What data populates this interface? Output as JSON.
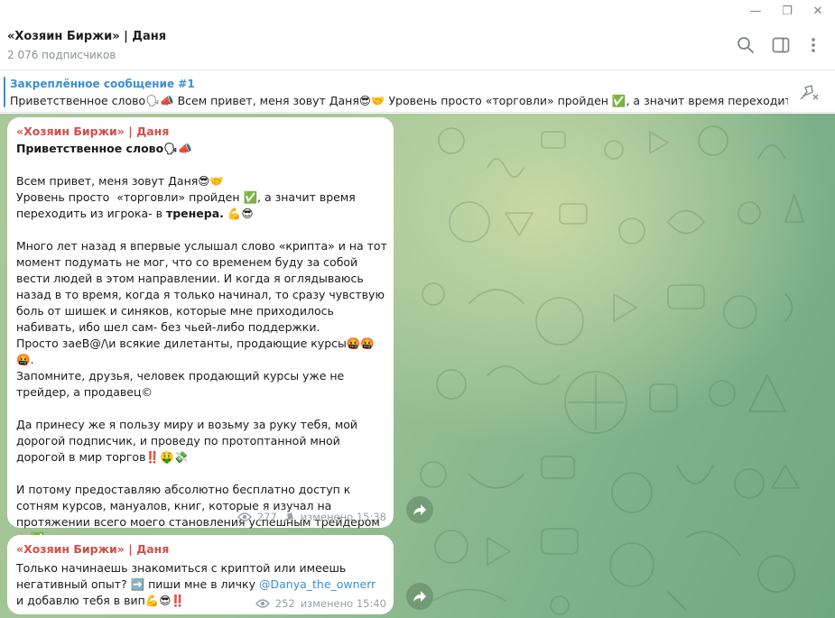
{
  "window": {
    "min": "—",
    "max": "❐",
    "close": "✕"
  },
  "header": {
    "title": "«Хозяин Биржи» | Даня",
    "subtitle": "2 076 подписчиков"
  },
  "pinned": {
    "title": "Закреплённое сообщение #1",
    "text": "Приветственное слово🗣📣  Всем привет, меня зовут Даня😎🤝 Уровень просто  «торговли» пройден ✅, а значит время переходит..."
  },
  "messages": [
    {
      "sender": "«Хозяин Биржи» | Даня",
      "title_line": "Приветственное слово🗣📣",
      "p1": "Всем привет, меня зовут Даня😎🤝\nУровень просто  «торговли» пройден ✅, а значит время переходить из игрока- в ",
      "p1_bold": "тренера.",
      "p1_end": " 💪😎",
      "p2": "Много лет назад я впервые услышал слово «крипта» и на тот момент подумать не мог, что со временем буду за собой  вести людей в этом направлении. И когда я оглядываюсь назад в то время, когда я только начинал, то сразу чувствую боль от шишек и синяков, которые мне приходилось набивать, ибо шел сам- без чьей-либо поддержки.\nПросто заеВ@/\\и всякие дилетанты, продающие курсы🤬🤬🤬.\nЗапомните, друзья, человек продающий курсы уже не трейдер, а продавец©",
      "p3": "Да принесу же я пользу миру и возьму за руку тебя, мой дорогой подписчик, и проведу по протоптанной мной дорогой в мир торгов‼️🤑💸",
      "p4": "И потому предоставляю абсолютно бесплатно доступ к сотням курсов, мануалов, книг, которые я изучал на протяжении всего моего становления успешным трейдером 🤝✅",
      "views": "277",
      "edited": "изменено 15:38"
    },
    {
      "sender": "«Хозяин Биржи» | Даня",
      "t1": "Только начинаешь знакомиться с криптой или имеешь негативный опыт? ➡️ пиши мне в личку ",
      "link": "@Danya_the_ownerr",
      "t2": "  и добавлю тебя в вип💪😎‼️",
      "views": "252",
      "edited": "изменено 15:40"
    }
  ],
  "colors": {
    "accent": "#3a8fd2",
    "sender": "#d44d4a",
    "meta": "#9aa1a6"
  },
  "icons": [
    "search-icon",
    "sidebar-toggle-icon",
    "more-vertical-icon",
    "unpin-icon",
    "eye-icon",
    "pin-icon",
    "share-icon"
  ]
}
